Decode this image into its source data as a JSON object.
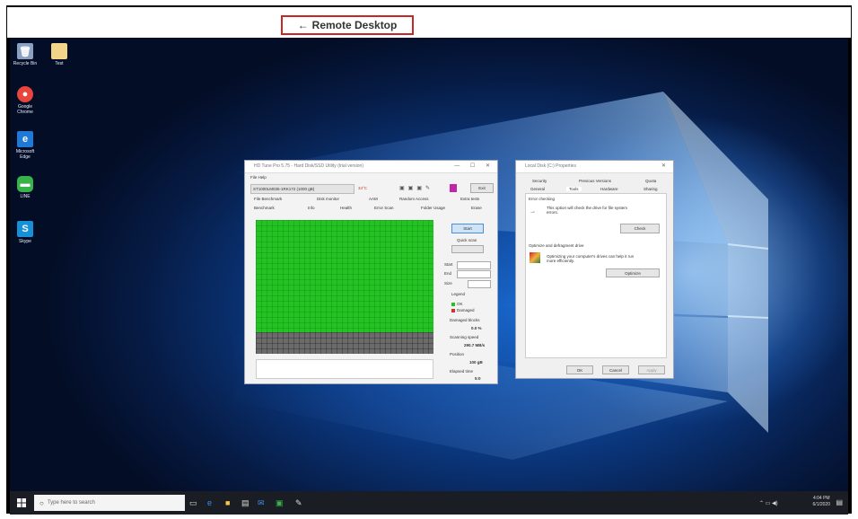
{
  "remote_desktop": {
    "arrow": "←",
    "label": "Remote Desktop"
  },
  "desktop_icons": [
    {
      "label": "Recycle Bin",
      "icon": "recycle-bin-icon",
      "color": "#8aa1c2"
    },
    {
      "label": "Test",
      "icon": "folder-icon",
      "color": "#f3d58a"
    },
    {
      "label": "Google Chrome",
      "icon": "chrome-icon",
      "color": "#e8453c"
    },
    {
      "label": "Microsoft Edge",
      "icon": "edge-icon",
      "color": "#1f79d6"
    },
    {
      "label": "LINE",
      "icon": "line-icon",
      "color": "#37b34a"
    },
    {
      "label": "Skype",
      "icon": "skype-icon",
      "color": "#1690d6"
    }
  ],
  "hdtune": {
    "title": "HD Tune Pro 5.75 - Hard Disk/SSD Utility (trial version)",
    "menu": "File  Help",
    "drive": "ST1000LM035-1RK172 (1000 gB)",
    "temp": "34°C",
    "exit": "Exit",
    "tabs": [
      "File Benchmark",
      "Disk monitor",
      "AAM",
      "Random Access",
      "Extra tests",
      "Benchmark",
      "Info",
      "Health",
      "Error Scan",
      "Folder Usage",
      "Erase"
    ],
    "start_label": "Start",
    "quick_scan": "Quick scan",
    "start_field": "Start",
    "end_field": "End",
    "size_field": "Size",
    "legend_title": "Legend",
    "legend_ok": "OK",
    "legend_damaged": "Damaged",
    "damaged_blocks_label": "Damaged blocks",
    "damaged_blocks_value": "0.0 %",
    "scanning_speed_label": "Scanning speed",
    "scanning_speed_value": "290.7 MB/s",
    "position_label": "Position",
    "position_value": "100 gB",
    "elapsed_label": "Elapsed time",
    "elapsed_value": "5:0"
  },
  "disk_props": {
    "title": "Local Disk (C:) Properties",
    "tabs_row1": [
      "Security",
      "Previous Versions",
      "Quota"
    ],
    "tabs_row2": [
      "General",
      "Tools",
      "Hardware",
      "Sharing"
    ],
    "error_heading": "Error checking",
    "error_text": "This option will check the drive for file system errors.",
    "check_button": "Check",
    "optimize_heading": "Optimize and defragment drive",
    "optimize_text": "Optimizing your computer's drives can help it run more efficiently.",
    "optimize_button": "Optimize",
    "ok": "OK",
    "cancel": "Cancel",
    "apply": "Apply"
  },
  "taskbar": {
    "search_placeholder": "Type here to search",
    "time": "4:04 PM",
    "date": "6/1/2020"
  }
}
